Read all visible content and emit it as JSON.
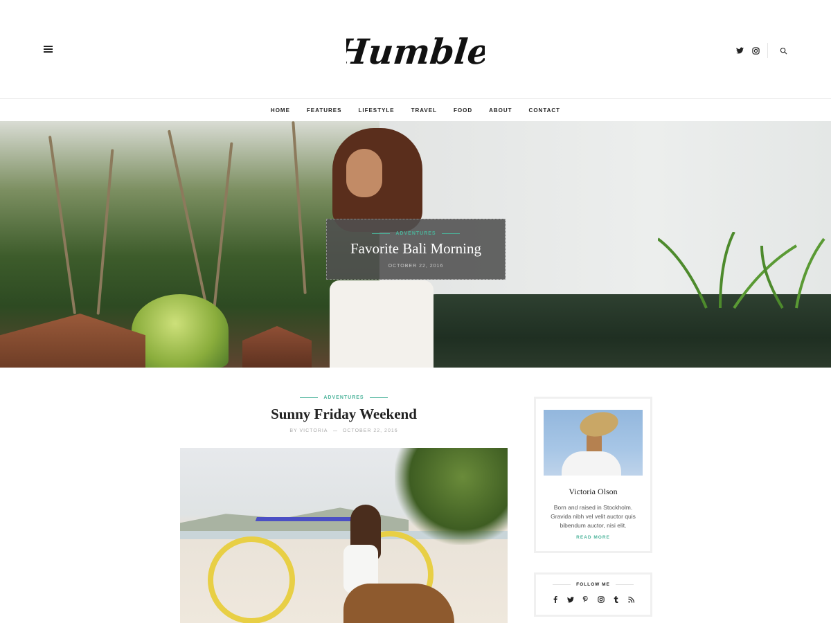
{
  "brand": {
    "logo_text": "Humble"
  },
  "nav": {
    "items": [
      {
        "label": "HOME"
      },
      {
        "label": "FEATURES"
      },
      {
        "label": "LIFESTYLE"
      },
      {
        "label": "TRAVEL"
      },
      {
        "label": "FOOD"
      },
      {
        "label": "ABOUT"
      },
      {
        "label": "CONTACT"
      }
    ]
  },
  "header_icons": [
    "twitter-icon",
    "instagram-icon",
    "search-icon"
  ],
  "hero": {
    "category": "ADVENTURES",
    "title": "Favorite Bali Morning",
    "date": "OCTOBER 22, 2016"
  },
  "post": {
    "category": "ADVENTURES",
    "title": "Sunny Friday Weekend",
    "author": "BY VICTORIA",
    "date": "OCTOBER 22, 2016"
  },
  "sidebar": {
    "about": {
      "name": "Victoria Olson",
      "text": "Born and raised in Stockholm. Gravida nibh vel velit auctor quis bibendum auctor, nisi elit.",
      "read_more": "READ MORE"
    },
    "follow": {
      "title": "FOLLOW ME",
      "icons": [
        "facebook-icon",
        "twitter-icon",
        "pinterest-icon",
        "instagram-icon",
        "tumblr-icon",
        "rss-icon"
      ]
    }
  },
  "colors": {
    "accent": "#4bb39a",
    "text": "#222222",
    "hero_overlay": "#505050"
  }
}
